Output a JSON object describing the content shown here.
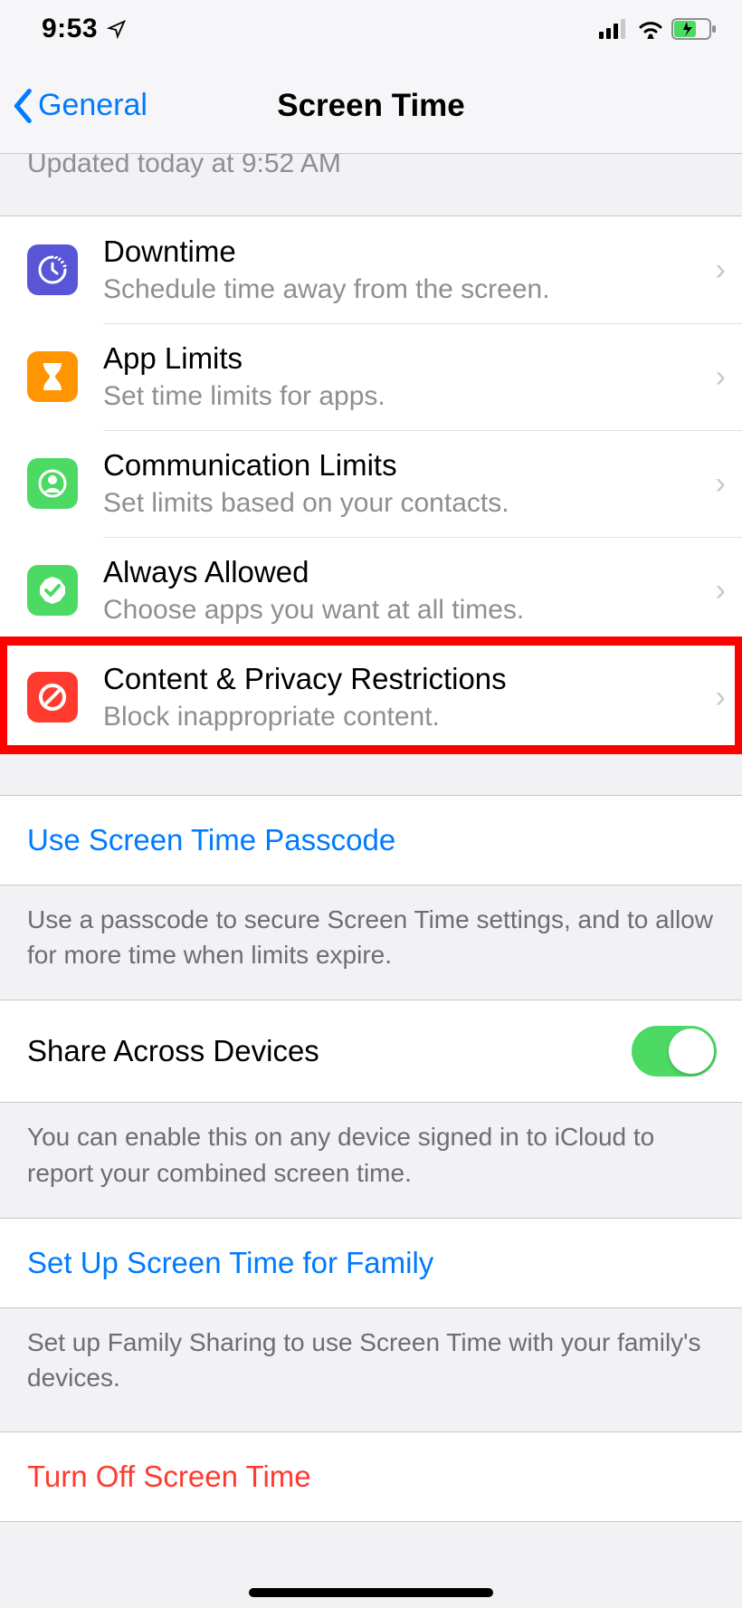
{
  "status": {
    "time": "9:53",
    "location_arrow": "↗"
  },
  "nav": {
    "back_label": "General",
    "title": "Screen Time"
  },
  "partial_update_text": "Updated today at 9:52 AM",
  "rows": {
    "downtime": {
      "title": "Downtime",
      "sub": "Schedule time away from the screen."
    },
    "applimits": {
      "title": "App Limits",
      "sub": "Set time limits for apps."
    },
    "commlimits": {
      "title": "Communication Limits",
      "sub": "Set limits based on your contacts."
    },
    "always": {
      "title": "Always Allowed",
      "sub": "Choose apps you want at all times."
    },
    "contentpriv": {
      "title": "Content & Privacy Restrictions",
      "sub": "Block inappropriate content."
    }
  },
  "passcode": {
    "link": "Use Screen Time Passcode",
    "footer": "Use a passcode to secure Screen Time settings, and to allow for more time when limits expire."
  },
  "share": {
    "label": "Share Across Devices",
    "on": true,
    "footer": "You can enable this on any device signed in to iCloud to report your combined screen time."
  },
  "family": {
    "link": "Set Up Screen Time for Family",
    "footer": "Set up Family Sharing to use Screen Time with your family's devices."
  },
  "turnoff": {
    "label": "Turn Off Screen Time"
  },
  "colors": {
    "downtime": "#5856d6",
    "applimits": "#ff9500",
    "commlimits": "#4cd964",
    "always": "#4cd964",
    "contentpriv": "#ff3b30"
  }
}
